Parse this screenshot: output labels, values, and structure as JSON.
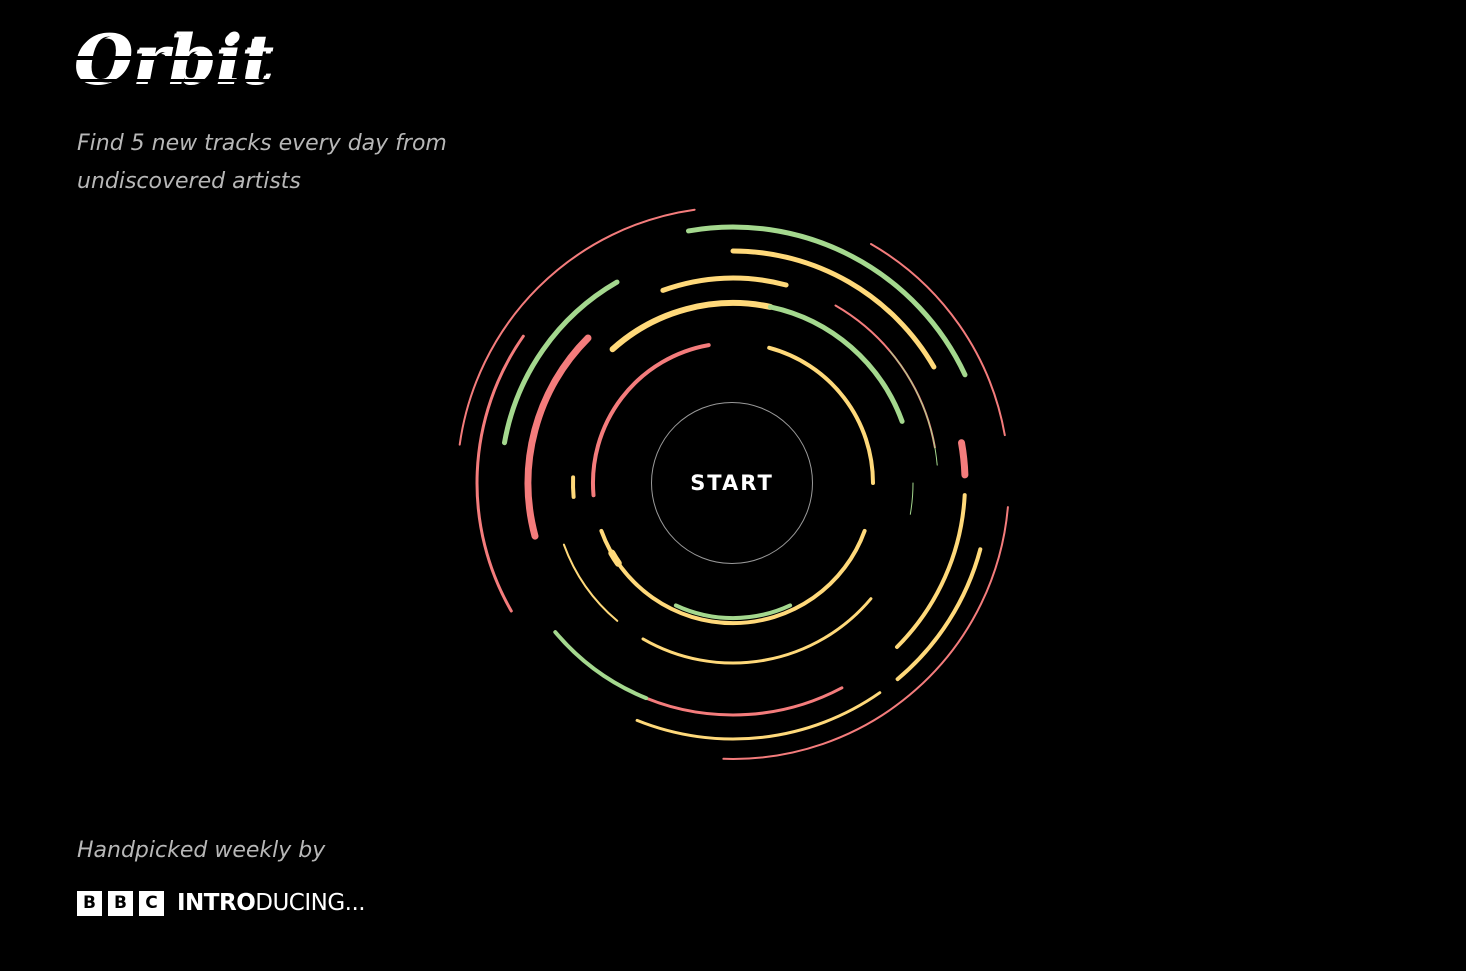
{
  "app": {
    "logo_text": "Orbit",
    "tagline": "Find 5 new tracks every day from undiscovered artists"
  },
  "orbit": {
    "start_label": "START",
    "colors": {
      "red": "#f47c7c",
      "green": "#a4d88e",
      "yellow": "#ffd97a"
    }
  },
  "footer": {
    "label": "Handpicked weekly by",
    "brand": {
      "blocks": [
        "B",
        "B",
        "C"
      ],
      "intro_bold": "INTRO",
      "intro_rest": "DUCING..."
    }
  }
}
